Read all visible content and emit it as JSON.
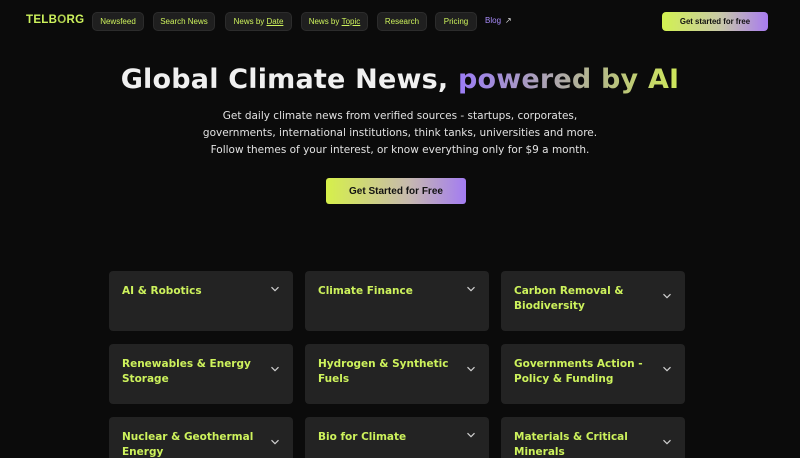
{
  "nav": {
    "logo_pre": "TELB",
    "logo_o": "O",
    "logo_post": "RG",
    "items": [
      {
        "label": "Newsfeed"
      },
      {
        "label": "Search News"
      },
      {
        "label_pre": "News by ",
        "label_u": "Date"
      },
      {
        "label_pre": "News by ",
        "label_u": "Topic"
      },
      {
        "label": "Research"
      },
      {
        "label": "Pricing"
      }
    ],
    "blog_label": "Blog",
    "blog_icon": "external-arrow-icon",
    "cta_label": "Get started for free"
  },
  "hero": {
    "title_plain": "Global Climate News, ",
    "title_gradient": "powered by AI",
    "subtitle_line1": "Get daily climate news from verified sources - startups, corporates,",
    "subtitle_line2": "governments, international institutions, think tanks, universities and more.",
    "subtitle_line3": "Follow themes of your interest, or know everything only for $9 a month.",
    "cta_label": "Get Started for Free"
  },
  "topics": [
    {
      "label": "AI & Robotics"
    },
    {
      "label": "Climate Finance"
    },
    {
      "label": "Carbon Removal & Biodiversity"
    },
    {
      "label": "Renewables & Energy Storage"
    },
    {
      "label": "Hydrogen & Synthetic Fuels"
    },
    {
      "label": "Governments Action - Policy & Funding"
    },
    {
      "label": "Nuclear & Geothermal Energy"
    },
    {
      "label": "Bio for Climate"
    },
    {
      "label": "Materials & Critical Minerals"
    }
  ],
  "colors": {
    "background": "#0b0b0b",
    "accent_lime": "#cdf25c",
    "accent_purple": "#a78bfa",
    "card_bg": "#232323"
  }
}
